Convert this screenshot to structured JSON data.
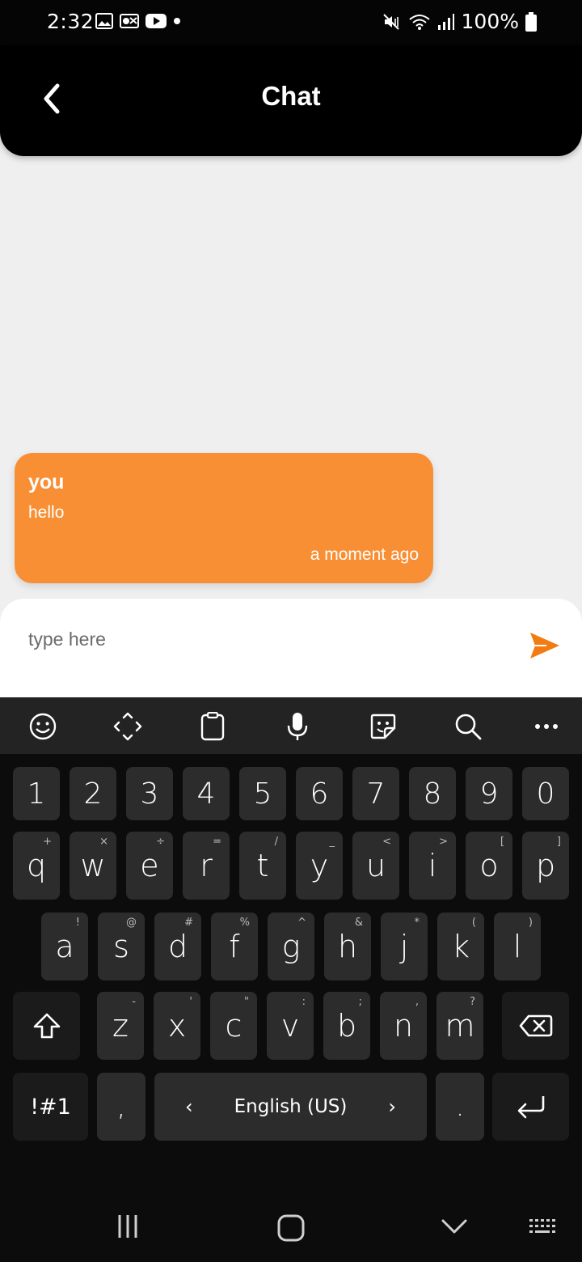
{
  "status_bar": {
    "time": "2:32",
    "battery": "100%"
  },
  "header": {
    "title": "Chat"
  },
  "messages": [
    {
      "sender": "you",
      "text": "hello",
      "time": "a moment ago"
    }
  ],
  "composer": {
    "placeholder": "type here"
  },
  "keyboard": {
    "number_row": [
      "1",
      "2",
      "3",
      "4",
      "5",
      "6",
      "7",
      "8",
      "9",
      "0"
    ],
    "row1": [
      {
        "key": "q",
        "alt": "+"
      },
      {
        "key": "w",
        "alt": "×"
      },
      {
        "key": "e",
        "alt": "÷"
      },
      {
        "key": "r",
        "alt": "="
      },
      {
        "key": "t",
        "alt": "/"
      },
      {
        "key": "y",
        "alt": "_"
      },
      {
        "key": "u",
        "alt": "<"
      },
      {
        "key": "i",
        "alt": ">"
      },
      {
        "key": "o",
        "alt": "["
      },
      {
        "key": "p",
        "alt": "]"
      }
    ],
    "row2": [
      {
        "key": "a",
        "alt": "!"
      },
      {
        "key": "s",
        "alt": "@"
      },
      {
        "key": "d",
        "alt": "#"
      },
      {
        "key": "f",
        "alt": "%"
      },
      {
        "key": "g",
        "alt": "^"
      },
      {
        "key": "h",
        "alt": "&"
      },
      {
        "key": "j",
        "alt": "*"
      },
      {
        "key": "k",
        "alt": "("
      },
      {
        "key": "l",
        "alt": ")"
      }
    ],
    "row3": [
      {
        "key": "z",
        "alt": "-"
      },
      {
        "key": "x",
        "alt": "'"
      },
      {
        "key": "c",
        "alt": "\""
      },
      {
        "key": "v",
        "alt": ":"
      },
      {
        "key": "b",
        "alt": ";"
      },
      {
        "key": "n",
        "alt": ","
      },
      {
        "key": "m",
        "alt": "?"
      }
    ],
    "symbols_label": "!#1",
    "comma": ",",
    "period": ".",
    "language": "English (US)"
  },
  "colors": {
    "accent": "#f98f34",
    "send": "#f27b12",
    "header_bg": "#000000",
    "chat_bg": "#efeff0",
    "key_bg": "#2c2c2c"
  },
  "icons": {
    "toolbar": [
      "emoji-icon",
      "cursor-move-icon",
      "clipboard-icon",
      "microphone-icon",
      "sticker-icon",
      "search-icon",
      "more-icon"
    ],
    "nav": [
      "recent-apps-icon",
      "home-icon",
      "hide-keyboard-icon",
      "keyboard-switch-icon"
    ]
  }
}
